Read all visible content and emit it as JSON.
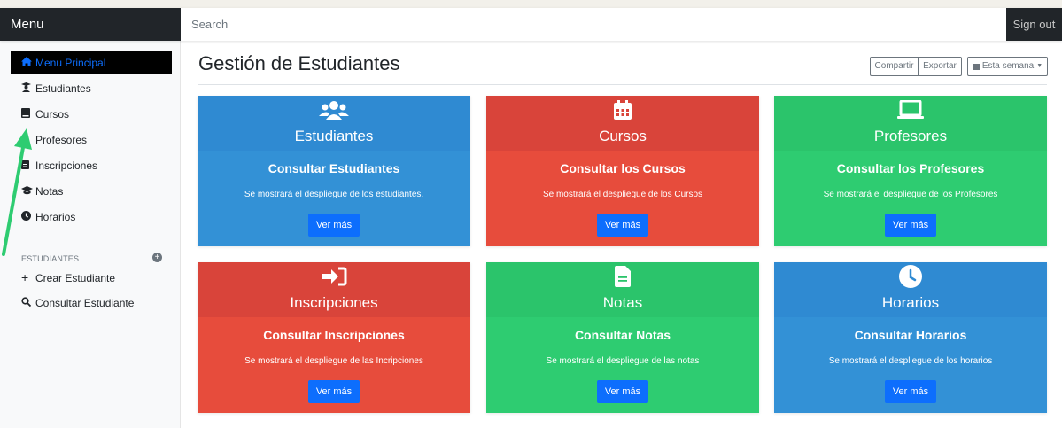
{
  "topbar": {
    "brand": "Menu",
    "search_placeholder": "Search",
    "signout": "Sign out"
  },
  "sidebar": {
    "items": [
      {
        "label": "Menu Principal",
        "icon": "home-icon"
      },
      {
        "label": "Estudiantes",
        "icon": "graduate-icon"
      },
      {
        "label": "Cursos",
        "icon": "book-icon"
      },
      {
        "label": "Profesores",
        "icon": "teacher-icon"
      },
      {
        "label": "Inscripciones",
        "icon": "clipboard-icon"
      },
      {
        "label": "Notas",
        "icon": "grad-cap-icon"
      },
      {
        "label": "Horarios",
        "icon": "clock-icon"
      }
    ],
    "section_heading": "ESTUDIANTES",
    "section_items": [
      {
        "label": "Crear Estudiante",
        "icon": "plus-icon"
      },
      {
        "label": "Consultar Estudiante",
        "icon": "search-icon"
      }
    ]
  },
  "main": {
    "title": "Gestión de Estudiantes",
    "toolbar": {
      "share": "Compartir",
      "export": "Exportar",
      "range": "Esta semana"
    },
    "cards": [
      {
        "name": "Estudiantes",
        "sub": "Consultar Estudiantes",
        "desc": "Se mostrará el despliegue de los estudiantes.",
        "button": "Ver más",
        "icon": "users-icon",
        "color": "#3391d6",
        "head_color": "#2f8ad2"
      },
      {
        "name": "Cursos",
        "sub": "Consultar los Cursos",
        "desc": "Se mostrará el despliegue de los Cursos",
        "button": "Ver más",
        "icon": "calendar-icon",
        "color": "#e74c3c",
        "head_color": "#d9443a"
      },
      {
        "name": "Profesores",
        "sub": "Consultar los Profesores",
        "desc": "Se mostrará el despliegue de los Profesores",
        "button": "Ver más",
        "icon": "laptop-icon",
        "color": "#2ecc71",
        "head_color": "#2bc46b"
      },
      {
        "name": "Inscripciones",
        "sub": "Consultar Inscripciones",
        "desc": "Se mostrará el despliegue de las Incripciones",
        "button": "Ver más",
        "icon": "sign-in-icon",
        "color": "#e74c3c",
        "head_color": "#d9443a"
      },
      {
        "name": "Notas",
        "sub": "Consultar Notas",
        "desc": "Se mostrará el despliegue de las notas",
        "button": "Ver más",
        "icon": "file-icon",
        "color": "#2ecc71",
        "head_color": "#2bc46b"
      },
      {
        "name": "Horarios",
        "sub": "Consultar Horarios",
        "desc": "Se mostrará el despliegue de los horarios",
        "button": "Ver más",
        "icon": "clock-icon",
        "color": "#3391d6",
        "head_color": "#2f8ad2"
      }
    ]
  },
  "colors": {
    "accent": "#0d6efd",
    "dark": "#212529",
    "annotation_arrow": "#2ecc71"
  }
}
